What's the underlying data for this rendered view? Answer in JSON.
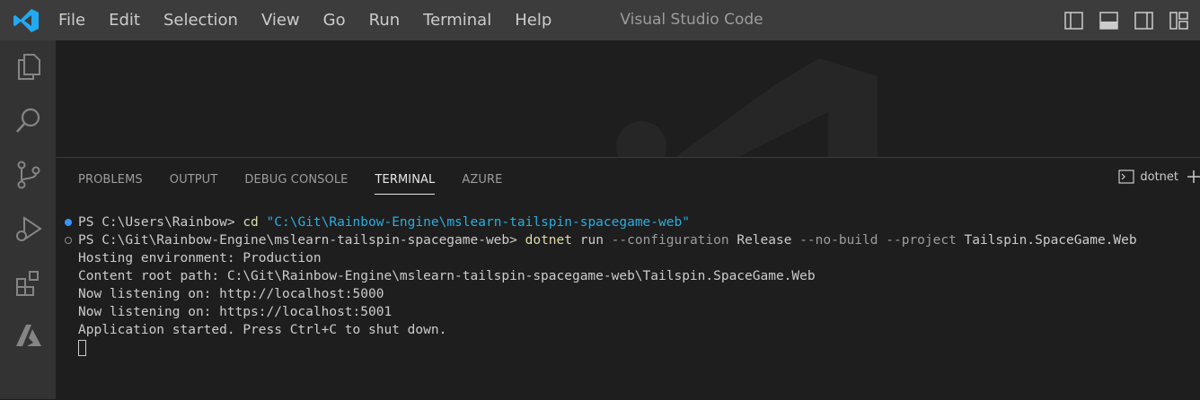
{
  "titlebar": {
    "menu": [
      "File",
      "Edit",
      "Selection",
      "View",
      "Go",
      "Run",
      "Terminal",
      "Help"
    ],
    "title": "Visual Studio Code"
  },
  "activity_bar": [
    "explorer-icon",
    "search-icon",
    "source-control-icon",
    "run-debug-icon",
    "extensions-icon",
    "azure-icon"
  ],
  "panel": {
    "tabs": [
      "PROBLEMS",
      "OUTPUT",
      "DEBUG CONSOLE",
      "TERMINAL",
      "AZURE"
    ],
    "active_tab": "TERMINAL",
    "terminal_name": "dotnet"
  },
  "terminal": {
    "line1": {
      "prompt": "PS C:\\Users\\Rainbow> ",
      "cmd": "cd",
      "arg": "\"C:\\Git\\Rainbow-Engine\\mslearn-tailspin-spacegame-web\""
    },
    "line2": {
      "prompt": "PS C:\\Git\\Rainbow-Engine\\mslearn-tailspin-spacegame-web> ",
      "cmd": "dotnet",
      "parts": [
        " run ",
        "--configuration",
        " Release ",
        "--no-build",
        " ",
        "--project",
        " Tailspin.SpaceGame.Web"
      ]
    },
    "output": [
      "Hosting environment: Production",
      "Content root path: C:\\Git\\Rainbow-Engine\\mslearn-tailspin-spacegame-web\\Tailspin.SpaceGame.Web",
      "Now listening on: http://localhost:5000",
      "Now listening on: https://localhost:5001",
      "Application started. Press Ctrl+C to shut down."
    ]
  },
  "colors": {
    "accent": "#3794ff",
    "command": "#dcdcaa",
    "string": "#2aaddf",
    "param": "#9d9d9d"
  }
}
